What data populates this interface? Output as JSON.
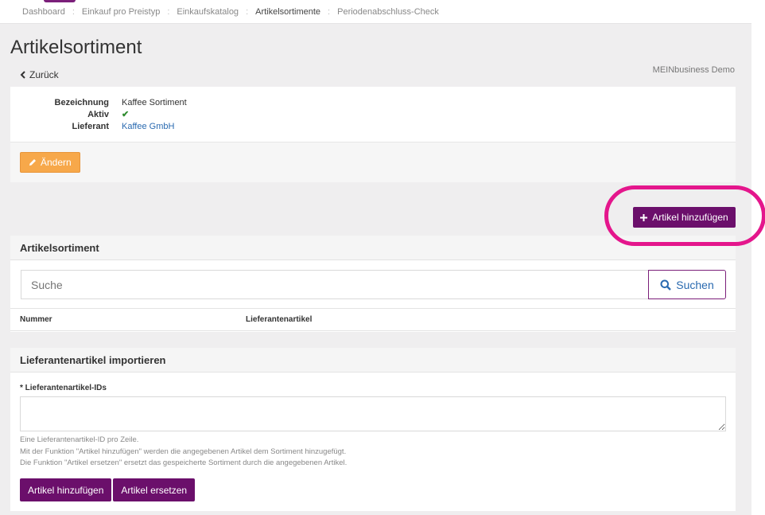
{
  "breadcrumb": [
    {
      "label": "Dashboard",
      "active": false
    },
    {
      "label": "Einkauf pro Preistyp",
      "active": false
    },
    {
      "label": "Einkaufskatalog",
      "active": false
    },
    {
      "label": "Artikelsortimente",
      "active": true
    },
    {
      "label": "Periodenabschluss-Check",
      "active": false
    }
  ],
  "breadcrumb_separator": ":",
  "page": {
    "title": "Artikelsortiment",
    "back_label": "Zurück",
    "company": "MEINbusiness Demo"
  },
  "details": {
    "rows": [
      {
        "label": "Bezeichnung",
        "value": "Kaffee Sortiment"
      },
      {
        "label": "Aktiv",
        "value": "✔"
      },
      {
        "label": "Lieferant",
        "value": "Kaffee GmbH"
      }
    ],
    "edit_label": "Ändern"
  },
  "actions": {
    "add_article_label": "Artikel hinzufügen"
  },
  "assortment": {
    "heading": "Artikelsortiment",
    "search_placeholder": "Suche",
    "search_button": "Suchen",
    "columns": [
      "Nummer",
      "Lieferantenartikel"
    ]
  },
  "import": {
    "heading": "Lieferantenartikel importieren",
    "field_label": "* Lieferantenartikel-IDs",
    "help_lines": [
      "Eine Lieferantenartikel-ID pro Zeile.",
      "Mit der Funktion \"Artikel hinzufügen\" werden die angegebenen Artikel dem Sortiment hinzugefügt.",
      "Die Funktion \"Artikel ersetzen\" ersetzt das gespeicherte Sortiment durch die angegebenen Artikel."
    ],
    "add_button": "Artikel hinzufügen",
    "replace_button": "Artikel ersetzen"
  },
  "colors": {
    "primary": "#6b0f6b",
    "warning": "#f7a84a",
    "highlight": "#e4168c",
    "link": "#2a6ab0",
    "success": "#2e8b2e"
  }
}
